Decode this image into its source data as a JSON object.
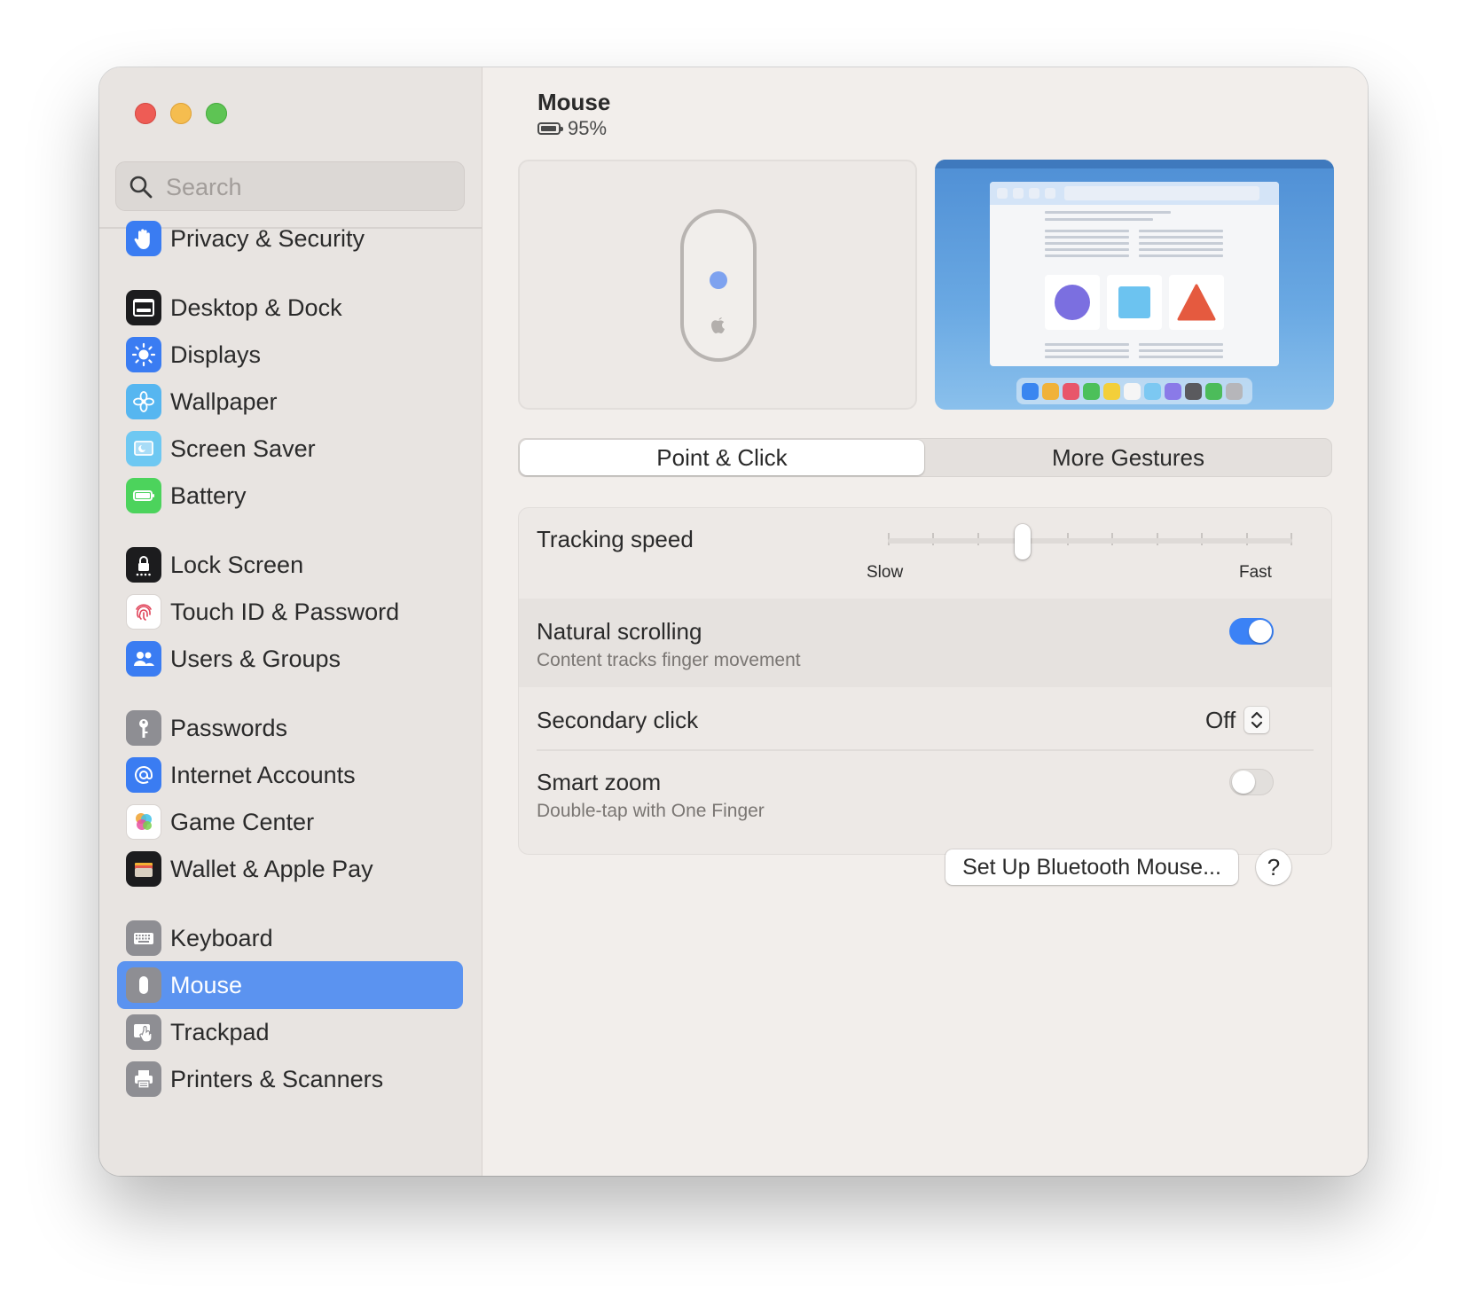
{
  "window": {
    "title": "Mouse"
  },
  "search": {
    "placeholder": "Search"
  },
  "sidebar": {
    "items": [
      {
        "label": "Privacy & Security",
        "icon": "hand-icon",
        "color": "#3a7cf2"
      },
      {
        "label": "Desktop & Dock",
        "icon": "dock-icon",
        "color": "#1c1c1e"
      },
      {
        "label": "Displays",
        "icon": "sun-icon",
        "color": "#3a7cf2"
      },
      {
        "label": "Wallpaper",
        "icon": "flower-icon",
        "color": "#56b6f0"
      },
      {
        "label": "Screen Saver",
        "icon": "screen-saver-icon",
        "color": "#6ec8f2"
      },
      {
        "label": "Battery",
        "icon": "battery-icon",
        "color": "#4cd35c"
      },
      {
        "label": "Lock Screen",
        "icon": "lock-icon",
        "color": "#1c1c1e"
      },
      {
        "label": "Touch ID & Password",
        "icon": "fingerprint-icon",
        "color": "#ffffff"
      },
      {
        "label": "Users & Groups",
        "icon": "users-icon",
        "color": "#3a7cf2"
      },
      {
        "label": "Passwords",
        "icon": "key-icon",
        "color": "#8e8e93"
      },
      {
        "label": "Internet Accounts",
        "icon": "at-icon",
        "color": "#3a7cf2"
      },
      {
        "label": "Game Center",
        "icon": "game-center-icon",
        "color": "#ffffff"
      },
      {
        "label": "Wallet & Apple Pay",
        "icon": "wallet-icon",
        "color": "#1c1c1e"
      },
      {
        "label": "Keyboard",
        "icon": "keyboard-icon",
        "color": "#8e8e93"
      },
      {
        "label": "Mouse",
        "icon": "mouse-icon",
        "color": "#8e8e93",
        "selected": true
      },
      {
        "label": "Trackpad",
        "icon": "trackpad-icon",
        "color": "#8e8e93"
      },
      {
        "label": "Printers & Scanners",
        "icon": "printer-icon",
        "color": "#8e8e93"
      }
    ]
  },
  "header": {
    "title": "Mouse",
    "battery_text": "95%",
    "battery_level": 0.95
  },
  "tabs": [
    {
      "label": "Point & Click",
      "active": true
    },
    {
      "label": "More Gestures",
      "active": false
    }
  ],
  "settings": {
    "tracking_speed": {
      "label": "Tracking speed",
      "min_label": "Slow",
      "max_label": "Fast",
      "ticks": 10,
      "value_index": 3
    },
    "natural_scrolling": {
      "label": "Natural scrolling",
      "sublabel": "Content tracks finger movement",
      "on": true
    },
    "secondary_click": {
      "label": "Secondary click",
      "value": "Off"
    },
    "smart_zoom": {
      "label": "Smart zoom",
      "sublabel": "Double-tap with One Finger",
      "on": false
    }
  },
  "buttons": {
    "setup_bluetooth": "Set Up Bluetooth Mouse...",
    "help": "?"
  },
  "colors": {
    "accent": "#3b82f6",
    "sidebar_selected": "#5b93f0"
  }
}
